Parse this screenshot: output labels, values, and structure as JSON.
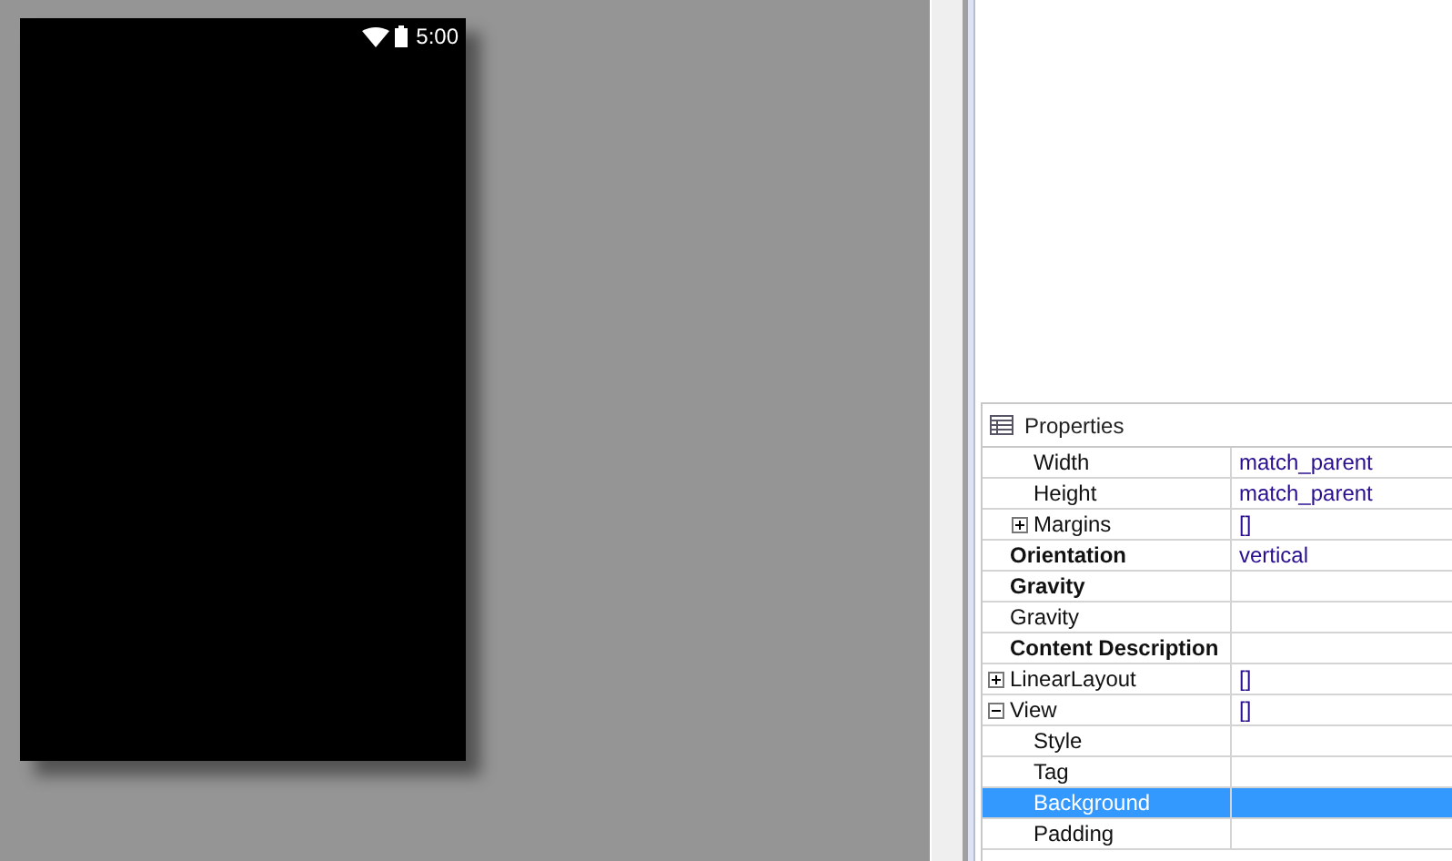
{
  "phone": {
    "status_time": "5:00"
  },
  "properties": {
    "title": "Properties",
    "rows": [
      {
        "children": [
          {
            "label": "Width",
            "value": "match_parent",
            "kind": "property",
            "selected": false
          },
          {
            "label": "Height",
            "value": "match_parent",
            "kind": "property",
            "selected": false
          },
          {
            "label": "Margins",
            "value": "[]",
            "kind": "property",
            "expanded": false,
            "selected": false
          }
        ]
      },
      {
        "label": "Orientation",
        "value": "vertical",
        "kind": "category",
        "selected": false
      },
      {
        "label": "Gravity",
        "kind": "category",
        "selected": false
      },
      {
        "label": "Gravity",
        "kind": "property",
        "selected": false
      },
      {
        "label": "Content Description",
        "kind": "category",
        "selected": false
      },
      {
        "label": "LinearLayout",
        "value": "[]",
        "kind": "property",
        "expanded": false,
        "selected": false
      },
      {
        "label": "View",
        "value": "[]",
        "kind": "property",
        "expanded": true,
        "selected": false,
        "children": [
          {
            "label": "Style",
            "kind": "property",
            "selected": false
          },
          {
            "label": "Tag",
            "kind": "property",
            "selected": false
          },
          {
            "label": "Background",
            "kind": "property",
            "selected": true
          },
          {
            "label": "Padding",
            "kind": "property",
            "selected": false
          }
        ]
      }
    ]
  }
}
